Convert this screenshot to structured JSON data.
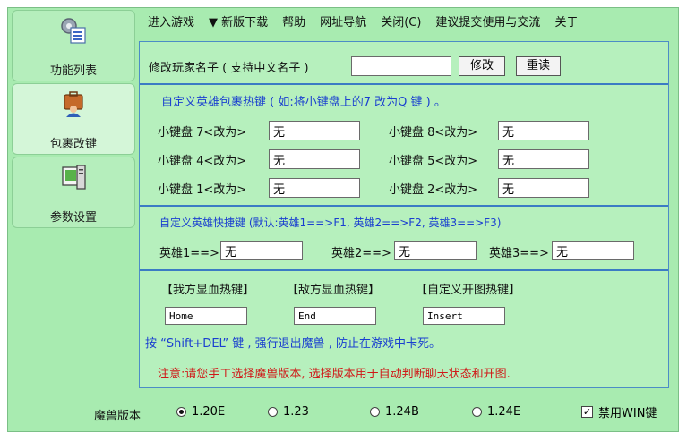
{
  "sidebar": {
    "items": [
      {
        "label": "功能列表",
        "icon": "settings-list-icon"
      },
      {
        "label": "包裹改键",
        "icon": "briefcase-person-icon"
      },
      {
        "label": "参数设置",
        "icon": "computer-icon"
      }
    ]
  },
  "menu": {
    "items": [
      "进入游戏",
      "▼ 新版下载",
      "帮助",
      "网址导航",
      "关闭(C)",
      "建议提交使用与交流",
      "关于"
    ]
  },
  "rename": {
    "label": "修改玩家名子 ( 支持中文名子 )",
    "value": "",
    "modify_button": "修改",
    "reread_button": "重读"
  },
  "bag_keys": {
    "heading": "自定义英雄包裹热键 ( 如:将小键盘上的7 改为Q 键 ) 。",
    "rows": [
      {
        "left_label": "小键盘 7<改为>",
        "left_value": "无",
        "right_label": "小键盘 8<改为>",
        "right_value": "无"
      },
      {
        "left_label": "小键盘 4<改为>",
        "left_value": "无",
        "right_label": "小键盘 5<改为>",
        "right_value": "无"
      },
      {
        "left_label": "小键盘 1<改为>",
        "left_value": "无",
        "right_label": "小键盘 2<改为>",
        "right_value": "无"
      }
    ]
  },
  "hero_keys": {
    "heading": "自定义英雄快捷键 (默认:英雄1==>F1, 英雄2==>F2, 英雄3==>F3)",
    "items": [
      {
        "label": "英雄1==>",
        "value": "无"
      },
      {
        "label": "英雄2==>",
        "value": "无"
      },
      {
        "label": "英雄3==>",
        "value": "无"
      }
    ]
  },
  "hotkeys": {
    "labels": [
      "【我方显血热键】",
      "【敌方显血热键】",
      "【自定义开图热键】"
    ],
    "values": [
      "Home",
      "End",
      "Insert"
    ],
    "tip": "按 “Shift+DEL” 键 , 强行退出魔兽 , 防止在游戏中卡死。",
    "notice": "注意:请您手工选择魔兽版本, 选择版本用于自动判断聊天状态和开图."
  },
  "version": {
    "label": "魔兽版本",
    "options": [
      "1.20E",
      "1.23",
      "1.24B",
      "1.24E"
    ],
    "selected": "1.20E",
    "disable_win_label": "禁用WIN键",
    "disable_win_checked": true,
    "check_mark": "✓"
  },
  "colors": {
    "background": "#a8ebb0",
    "panel": "#b6f0bd",
    "divider": "#3b7bc4",
    "heading_blue": "#1a3fd0",
    "notice_red": "#d01818"
  }
}
